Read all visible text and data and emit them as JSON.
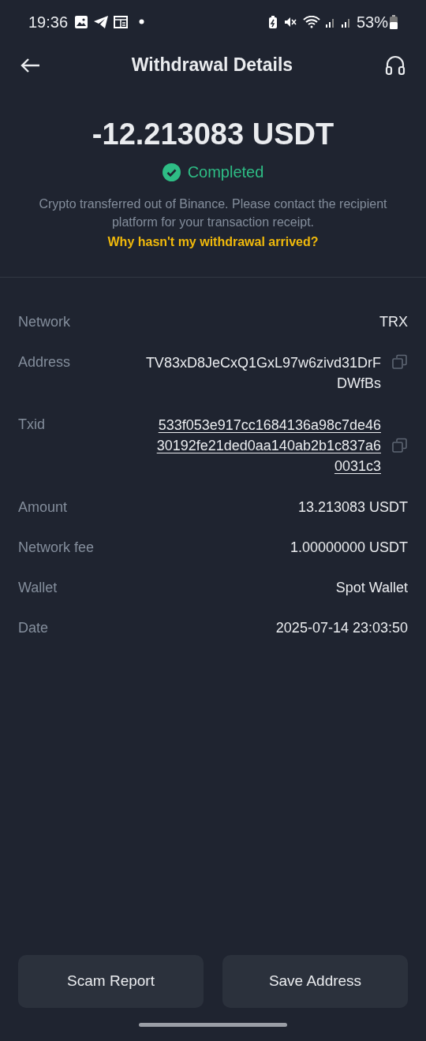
{
  "status_bar": {
    "time": "19:36",
    "battery": "53%"
  },
  "header": {
    "title": "Withdrawal Details"
  },
  "summary": {
    "amount": "-12.213083 USDT",
    "status": "Completed",
    "note": "Crypto transferred out of Binance. Please contact the recipient platform for your transaction receipt.",
    "help_link": "Why hasn't my withdrawal arrived?"
  },
  "details": [
    {
      "kind": "text",
      "label": "Network",
      "value": "TRX"
    },
    {
      "kind": "copy",
      "label": "Address",
      "value": "TV83xD8JeCxQ1GxL97w6zivd31DrFDWfBs"
    },
    {
      "kind": "link",
      "label": "Txid",
      "value": "533f053e917cc1684136a98c7de4630192fe21ded0aa140ab2b1c837a60031c3"
    },
    {
      "kind": "text",
      "label": "Amount",
      "value": "13.213083 USDT"
    },
    {
      "kind": "text",
      "label": "Network fee",
      "value": "1.00000000 USDT"
    },
    {
      "kind": "text",
      "label": "Wallet",
      "value": "Spot Wallet"
    },
    {
      "kind": "text",
      "label": "Date",
      "value": "2025-07-14 23:03:50"
    }
  ],
  "buttons": [
    "Scam Report",
    "Save Address"
  ]
}
